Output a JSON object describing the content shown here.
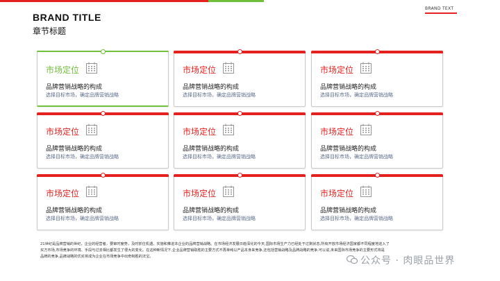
{
  "header": {
    "brand_title": "BRAND  TITLE",
    "chapter_title": "章节标题",
    "brand_text": "BRAND TEXT"
  },
  "colors": {
    "accent_red": "#e4211f",
    "accent_green": "#6fbf3b"
  },
  "cards": [
    {
      "title": "市场定位",
      "subtitle": "品牌营销战略的构成",
      "desc": "选择目标市场，确定品牌营销战略",
      "icon": "calendar-icon",
      "style": "green"
    },
    {
      "title": "市场定位",
      "subtitle": "品牌营销战略的构成",
      "desc": "选择目标市场，确定品牌营销战略",
      "icon": "calendar-icon",
      "style": "red"
    },
    {
      "title": "市场定位",
      "subtitle": "品牌营销战略的构成",
      "desc": "选择目标市场，确定品牌营销战略",
      "icon": "calendar-icon",
      "style": "red"
    },
    {
      "title": "市场定位",
      "subtitle": "品牌营销战略的构成",
      "desc": "选择目标市场，确定品牌营销战略",
      "icon": "calendar-icon",
      "style": "red"
    },
    {
      "title": "市场定位",
      "subtitle": "品牌营销战略的构成",
      "desc": "选择目标市场，确定品牌营销战略",
      "icon": "calendar-icon",
      "style": "red"
    },
    {
      "title": "市场定位",
      "subtitle": "品牌营销战略的构成",
      "desc": "选择目标市场，确定品牌营销战略",
      "icon": "calendar-icon",
      "style": "red"
    },
    {
      "title": "市场定位",
      "subtitle": "品牌营销战略的构成",
      "desc": "选择目标市场，确定品牌营销战略",
      "icon": "calendar-icon",
      "style": "red"
    },
    {
      "title": "市场定位",
      "subtitle": "品牌营销战略的构成",
      "desc": "选择目标市场，确定品牌营销战略",
      "icon": "calendar-icon",
      "style": "red"
    },
    {
      "title": "市场定位",
      "subtitle": "品牌营销战略的构成",
      "desc": "选择目标市场，确定品牌营销战略",
      "icon": "calendar-icon",
      "style": "red"
    }
  ],
  "footer": {
    "line1": "21世纪是品牌营销的世纪，企业的经营者，要审时度势，及时抓住机遇，实施和推进本企业的品牌营销战略。在市场经济发展日趋深化的今天,国际市场生产力已经处于过剩状态,所有开放市场经济国家都不同程度地进入了",
    "line2": "买方市场,市场竞争的环境、手段与过去相比都发生了很大的变化。在这种新情况下,企业品牌营销取胜的主要方式不再单纯以产品本身来竞争,还包括营销战略及品牌战略的竞争,可以说,未来国际市场竞争的主要形式将是",
    "line3": "品牌的竞争,品牌战略的优劣将成为企业在市场竞争中出奇制胜的法宝。"
  },
  "watermark": {
    "text": "公众号 · 肉眼品世界",
    "icon": "wechat-icon"
  }
}
